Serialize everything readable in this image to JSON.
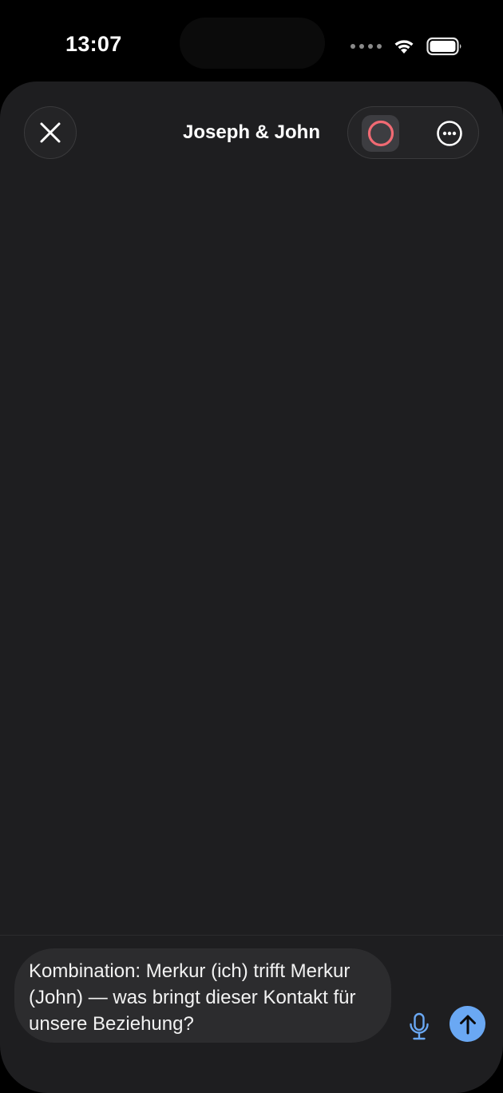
{
  "status_bar": {
    "time": "13:07",
    "icons": [
      "signal-dots-icon",
      "wifi-icon",
      "battery-icon"
    ]
  },
  "header": {
    "title": "Joseph & John",
    "close_icon": "close-icon",
    "record_icon": "record-icon",
    "more_icon": "more-icon"
  },
  "composer": {
    "message_text": "Kombination: Merkur (ich) trifft Merkur (John) — was bringt dieser Kontakt für unsere Beziehung?",
    "mic_icon": "mic-icon",
    "send_icon": "arrow-up-icon"
  },
  "colors": {
    "sheet_background": "#1e1e20",
    "accent_blue": "#6aa8f3",
    "record_red": "#f06a73"
  }
}
